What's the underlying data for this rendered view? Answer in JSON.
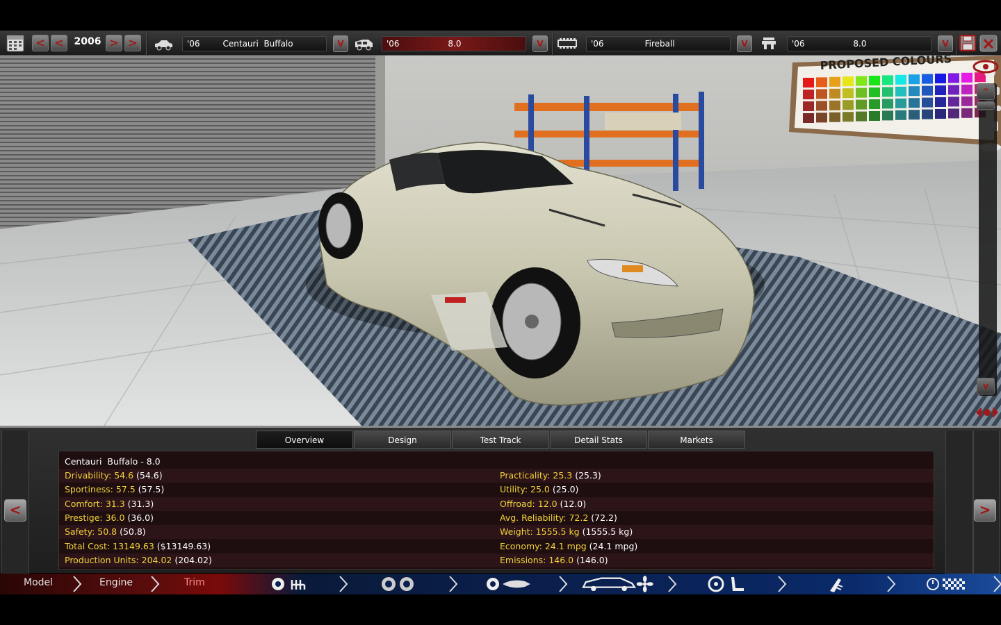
{
  "toolbar": {
    "prev_label": "<",
    "next_label": ">",
    "year": "2006",
    "dropdown_label": "V",
    "chassis": {
      "year": "'06",
      "name": "Centauri  Buffalo"
    },
    "body": {
      "year": "'06",
      "name": "8.0"
    },
    "engine": {
      "year": "'06",
      "name": "Fireball"
    },
    "trim": {
      "year": "'06",
      "name": "8.0"
    }
  },
  "scene": {
    "poster_text": "PROPOSED COLOURS",
    "car_color": "#c8c6ae",
    "up_label": "^",
    "down_label": "v"
  },
  "tabs": [
    {
      "label": "Overview",
      "active": true
    },
    {
      "label": "Design",
      "active": false
    },
    {
      "label": "Test Track",
      "active": false
    },
    {
      "label": "Detail Stats",
      "active": false
    },
    {
      "label": "Markets",
      "active": false
    }
  ],
  "stats": {
    "title": "Centauri  Buffalo - 8.0",
    "left": [
      {
        "label": "Drivability: 54.6",
        "value": " (54.6)"
      },
      {
        "label": "Sportiness: 57.5",
        "value": " (57.5)"
      },
      {
        "label": "Comfort: 31.3",
        "value": " (31.3)"
      },
      {
        "label": "Prestige: 36.0",
        "value": " (36.0)"
      },
      {
        "label": "Safety: 50.8",
        "value": " (50.8)"
      },
      {
        "label": "Total Cost: 13149.63",
        "value": " ($13149.63)"
      },
      {
        "label": "Production Units: 204.02",
        "value": " (204.02)"
      }
    ],
    "right": [
      {
        "label": "Practicality: 25.3",
        "value": " (25.3)"
      },
      {
        "label": "Utility: 25.0",
        "value": " (25.0)"
      },
      {
        "label": "Offroad: 12.0",
        "value": " (12.0)"
      },
      {
        "label": "Avg. Reliability: 72.2",
        "value": " (72.2)"
      },
      {
        "label": "Weight: 1555.5 kg",
        "value": " (1555.5 kg)"
      },
      {
        "label": "Economy: 24.1 mpg",
        "value": " (24.1 mpg)"
      },
      {
        "label": "Emissions: 146.0",
        "value": " (146.0)"
      }
    ]
  },
  "panel": {
    "left_arrow": "<",
    "right_arrow": ">"
  },
  "nav": {
    "model": "Model",
    "engine": "Engine",
    "trim": "Trim"
  },
  "colors": {
    "accent_red": "#a01818",
    "stat_label": "#f3d23a",
    "panel_bg": "#1e0e10"
  }
}
